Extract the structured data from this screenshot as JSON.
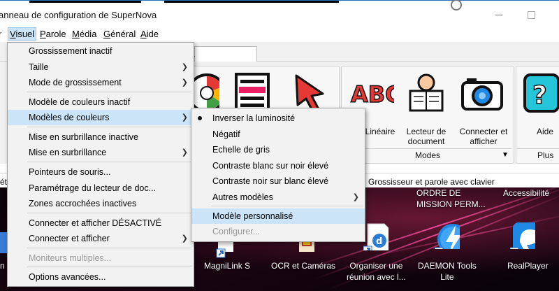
{
  "window": {
    "title": "anneau de configuration de SuperNova"
  },
  "menubar": {
    "items": [
      {
        "label": "r",
        "ul": ""
      },
      {
        "label": "Visuel",
        "ul": "V"
      },
      {
        "label": "Parole",
        "ul": "P"
      },
      {
        "label": "Média",
        "ul": "M"
      },
      {
        "label": "Général",
        "ul": "G"
      },
      {
        "label": "Aide",
        "ul": "A"
      }
    ]
  },
  "tabs": {
    "partial_label": "a"
  },
  "toolbar": {
    "tools": [
      {
        "label": "Linéaire",
        "icon": "abc-icon"
      },
      {
        "label": "Lecteur de\ndocument",
        "icon": "newspaper-reader-icon"
      },
      {
        "label": "Connecter et\nafficher",
        "icon": "camera-icon"
      },
      {
        "label": "Aide",
        "icon": "help-icon"
      }
    ],
    "groups": [
      {
        "label": "Modes"
      },
      {
        "label": "Plus"
      }
    ]
  },
  "status": {
    "text": "Grossisseur et parole avec clavier",
    "left_fragment": "ét"
  },
  "visuel_menu": {
    "items": [
      {
        "label": "Grossissement inactif",
        "arrow": false,
        "highlight": false,
        "disabled": false
      },
      {
        "label": "Taille",
        "arrow": true,
        "highlight": false,
        "disabled": false
      },
      {
        "label": "Mode de grossissement",
        "arrow": true,
        "highlight": false,
        "disabled": false
      },
      {
        "label": "Modèle de couleurs inactif",
        "arrow": false,
        "highlight": false,
        "disabled": false
      },
      {
        "label": "Modèles de couleurs",
        "arrow": true,
        "highlight": true,
        "disabled": false
      },
      {
        "label": "Mise en surbrillance inactive",
        "arrow": false,
        "highlight": false,
        "disabled": false
      },
      {
        "label": "Mise en surbrillance",
        "arrow": true,
        "highlight": false,
        "disabled": false
      },
      {
        "label": "Pointeurs de souris...",
        "arrow": false,
        "highlight": false,
        "disabled": false
      },
      {
        "label": "Paramétrage du lecteur de doc...",
        "arrow": false,
        "highlight": false,
        "disabled": false
      },
      {
        "label": "Zones accrochées inactives",
        "arrow": false,
        "highlight": false,
        "disabled": false
      },
      {
        "label": "Connecter et afficher DÉSACTIVÉ",
        "arrow": false,
        "highlight": false,
        "disabled": false
      },
      {
        "label": "Connecter et afficher",
        "arrow": true,
        "highlight": false,
        "disabled": false
      },
      {
        "label": "Moniteurs multiples...",
        "arrow": false,
        "highlight": false,
        "disabled": true
      },
      {
        "label": "Options avancées...",
        "arrow": false,
        "highlight": false,
        "disabled": false
      }
    ]
  },
  "couleurs_submenu": {
    "items": [
      {
        "label": "Inverser la luminosité",
        "checked": true,
        "arrow": false,
        "highlight": false,
        "disabled": false
      },
      {
        "label": "Négatif",
        "checked": false,
        "arrow": false,
        "highlight": false,
        "disabled": false
      },
      {
        "label": "Echelle de gris",
        "checked": false,
        "arrow": false,
        "highlight": false,
        "disabled": false
      },
      {
        "label": "Contraste blanc sur noir élevé",
        "checked": false,
        "arrow": false,
        "highlight": false,
        "disabled": false
      },
      {
        "label": "Contraste noir sur blanc élevé",
        "checked": false,
        "arrow": false,
        "highlight": false,
        "disabled": false
      },
      {
        "label": "Autres modèles",
        "checked": false,
        "arrow": true,
        "highlight": false,
        "disabled": false
      },
      {
        "label": "Modèle personnalisé",
        "checked": false,
        "arrow": false,
        "highlight": true,
        "disabled": false
      },
      {
        "label": "Configurer...",
        "checked": false,
        "arrow": false,
        "highlight": false,
        "disabled": true
      }
    ]
  },
  "desktop": {
    "icons": [
      {
        "label": "MagniLink S",
        "icon": "magnilink-icon"
      },
      {
        "label": "OCR et Caméras",
        "icon": "ocr-camera-icon"
      },
      {
        "label": "Organiser une\nréunion avec l...",
        "icon": "document-meeting-icon"
      },
      {
        "label": "DAEMON Tools\nLite",
        "icon": "daemon-tools-icon"
      },
      {
        "label": "RealPlayer",
        "icon": "realplayer-icon"
      }
    ],
    "top_labels": [
      {
        "label": "ORDRE DE\nMISSION PERM..."
      },
      {
        "label": "Accessibilité"
      }
    ],
    "left_fragment": "n"
  },
  "colors": {
    "highlight": "#cce4f7",
    "menu_bg": "#f2f2f2",
    "disabled_text": "#9a9a9a"
  }
}
